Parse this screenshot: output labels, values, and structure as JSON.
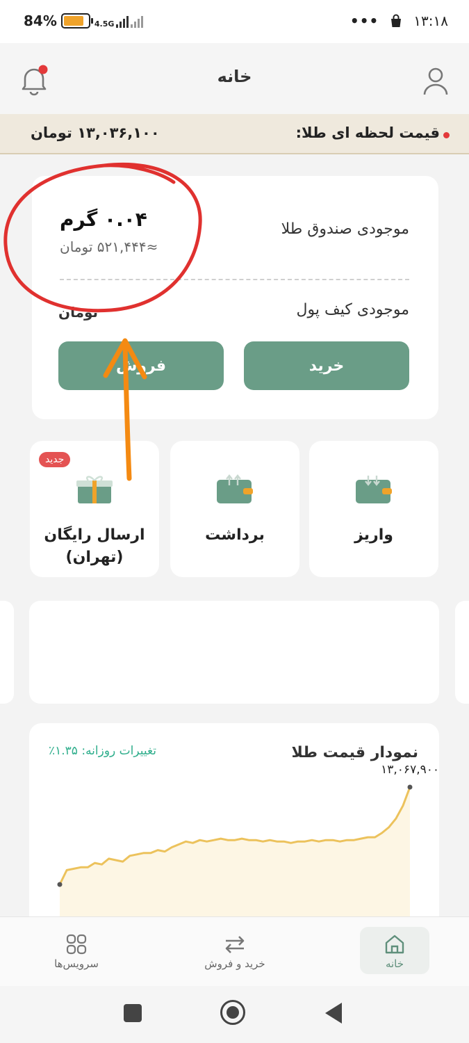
{
  "status_bar": {
    "battery_percent": "84%",
    "network_type": "4.5G",
    "overflow_dots": "•••",
    "time": "۱۳:۱۸"
  },
  "header": {
    "title": "خانه",
    "notification_icon": "bell-icon",
    "profile_icon": "user-icon"
  },
  "price_bar": {
    "label": "قیمت لحظه ای طلا:",
    "value": "۱۳,۰۳۶,۱۰۰ تومان",
    "live_dot_color": "#e3393a"
  },
  "balance_card": {
    "gold_label": "موجودی صندوق طلا",
    "gold_amount": "۰.۰۴ گرم",
    "gold_toman": "≈۵۲۱,۴۴۴ تومان",
    "wallet_label": "موجودی کیف پول",
    "wallet_value": "تومان",
    "buy_label": "خرید",
    "sell_label": "فروش"
  },
  "actions": [
    {
      "label": "واریز",
      "icon": "wallet-deposit-icon"
    },
    {
      "label": "برداشت",
      "icon": "wallet-withdraw-icon"
    },
    {
      "label": "ارسال رایگان\n(تهران)",
      "icon": "gift-icon",
      "badge": "جدید"
    }
  ],
  "chart": {
    "title": "نمودار قیمت طلا",
    "daily_change": "تغییرات روزانه: ۱.۳۵٪",
    "last_value_label": "۱۳,۰۶۷,۹۰۰",
    "line_color": "#ecc25c"
  },
  "chart_data": {
    "type": "line",
    "x": [
      0,
      1,
      2,
      3,
      4,
      5,
      6,
      7,
      8,
      9,
      10,
      11,
      12,
      13,
      14,
      15,
      16,
      17,
      18,
      19,
      20,
      21,
      22,
      23,
      24,
      25,
      26,
      27,
      28,
      29,
      30,
      31,
      32,
      33,
      34,
      35,
      36,
      37,
      38,
      39,
      40,
      41,
      42,
      43,
      44,
      45,
      46,
      47,
      48,
      49,
      50
    ],
    "values": [
      13.0,
      13.01,
      13.011,
      13.012,
      13.012,
      13.015,
      13.014,
      13.018,
      13.017,
      13.016,
      13.02,
      13.021,
      13.022,
      13.022,
      13.024,
      13.023,
      13.026,
      13.028,
      13.03,
      13.029,
      13.031,
      13.03,
      13.031,
      13.032,
      13.031,
      13.031,
      13.032,
      13.031,
      13.031,
      13.03,
      13.031,
      13.03,
      13.03,
      13.029,
      13.03,
      13.03,
      13.031,
      13.03,
      13.031,
      13.031,
      13.03,
      13.031,
      13.031,
      13.032,
      13.033,
      13.033,
      13.036,
      13.04,
      13.046,
      13.055,
      13.068
    ],
    "ylabel": "",
    "xlabel": "",
    "last_point_annotation": "۱۳,۰۶۷,۹۰۰"
  },
  "bottom_nav": {
    "home": "خانه",
    "trade": "خرید و فروش",
    "services": "سرویس‌ها"
  },
  "colors": {
    "accent": "#6a9d87",
    "price_bar_bg": "#efe9dd",
    "annotation_circle": "#e0312f",
    "annotation_arrow": "#f48a12"
  }
}
